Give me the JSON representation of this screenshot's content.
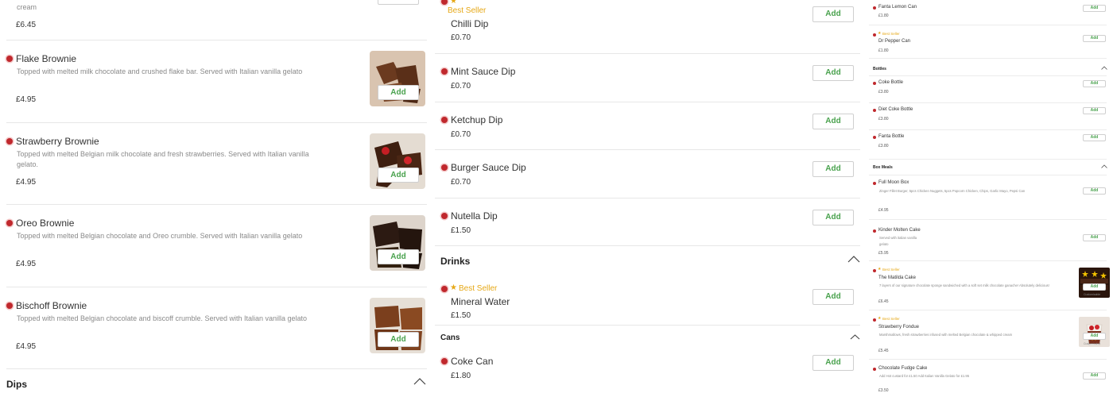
{
  "left": {
    "partial_item": {
      "desc_tail": "cream",
      "price": "£6.45"
    },
    "items": [
      {
        "name": "Flake Brownie",
        "desc": "Topped with melted milk chocolate and crushed flake bar. Served with Italian vanilla gelato",
        "price": "£4.95",
        "add": "Add"
      },
      {
        "name": "Strawberry Brownie",
        "desc": "Topped with melted Belgian milk chocolate and fresh strawberries. Served with Italian vanilla gelato.",
        "price": "£4.95",
        "add": "Add"
      },
      {
        "name": "Oreo Brownie",
        "desc": "Topped with melted Belgian chocolate and Oreo crumble. Served with Italian vanilla gelato",
        "price": "£4.95",
        "add": "Add"
      },
      {
        "name": "Bischoff Brownie",
        "desc": "Topped with melted Belgian chocolate and biscoff crumble. Served with Italian vanilla gelato",
        "price": "£4.95",
        "add": "Add"
      }
    ],
    "section_dips": "Dips"
  },
  "middle": {
    "best_seller": "Best Seller",
    "items_top": [
      {
        "name": "Chilli Dip",
        "price": "£0.70",
        "add": "Add"
      },
      {
        "name": "Mint Sauce Dip",
        "price": "£0.70",
        "add": "Add"
      },
      {
        "name": "Ketchup Dip",
        "price": "£0.70",
        "add": "Add"
      },
      {
        "name": "Burger Sauce Dip",
        "price": "£0.70",
        "add": "Add"
      },
      {
        "name": "Nutella Dip",
        "price": "£1.50",
        "add": "Add"
      }
    ],
    "section_drinks": "Drinks",
    "drinks": [
      {
        "name": "Mineral Water",
        "price": "£1.50",
        "add": "Add"
      }
    ],
    "section_cans": "Cans",
    "cans": [
      {
        "name": "Coke Can",
        "price": "£1.80",
        "add": "Add"
      }
    ]
  },
  "right": {
    "best_seller": "Best Seller",
    "cans": [
      {
        "name": "Fanta Lemon Can",
        "price": "£1.80",
        "add": "Add"
      },
      {
        "name": "Dr Pepper Can",
        "price": "£1.80",
        "add": "Add"
      }
    ],
    "section_bottles": "Bottles",
    "bottles": [
      {
        "name": "Coke Bottle",
        "price": "£3.80",
        "add": "Add"
      },
      {
        "name": "Diet Coke Bottle",
        "price": "£3.80",
        "add": "Add"
      },
      {
        "name": "Fanta Bottle",
        "price": "£3.80",
        "add": "Add"
      }
    ],
    "section_box": "Box Meals",
    "box": [
      {
        "name": "Full Moon Box",
        "desc": "Zinger Fillet Burger, 5pcs Chicken Nuggets, 5pcs Popcorn Chicken, Chips, Garlic Mayo, Pepsi Can",
        "price": "£4.95",
        "add": "Add"
      },
      {
        "name": "Kinder Molten Cake",
        "desc": "Served with italian vanilla gelato",
        "price": "£5.95",
        "add": "Add"
      },
      {
        "name": "The Matilda Cake",
        "desc": "7 layers of our signature chocolate sponge sandwiched with a soft set milk chocolate ganache! Absolutely delicious!",
        "price": "£6.45",
        "add": "Add",
        "customise": "Customisable"
      },
      {
        "name": "Strawberry Fondue",
        "desc": "Marshmallows, fresh strawberries infused with melted Belgian chocolate & whipped cream",
        "price": "£5.45",
        "add": "Add",
        "customise": "Customisable"
      },
      {
        "name": "Chocolate Fudge Cake",
        "desc": "Add Hot custard for £1.50 Add Italian Vanilla Gelato for £1.95",
        "price": "£3.50",
        "add": "Add"
      }
    ]
  },
  "colors": {
    "accent_green": "#4aa24e",
    "dot_red": "#c0282d",
    "best_seller_gold": "#e6a817"
  }
}
